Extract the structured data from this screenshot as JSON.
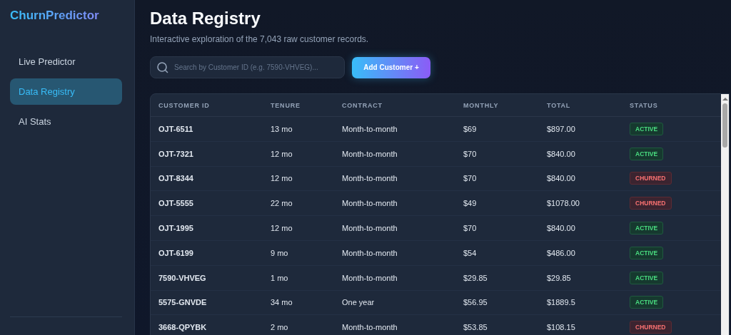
{
  "sidebar": {
    "logo": "ChurnPredictor",
    "items": [
      {
        "label": "Live Predictor",
        "selected": false
      },
      {
        "label": "Data Registry",
        "selected": true
      },
      {
        "label": "AI Stats",
        "selected": false
      }
    ]
  },
  "header": {
    "title": "Data Registry",
    "subtitle": "Interactive exploration of the 7,043 raw customer records."
  },
  "search": {
    "placeholder": "Search by Customer ID (e.g. 7590-VHVEG)..."
  },
  "add_button": "Add Customer +",
  "table": {
    "columns": [
      "CUSTOMER ID",
      "TENURE",
      "CONTRACT",
      "MONTHLY",
      "TOTAL",
      "STATUS"
    ],
    "rows": [
      {
        "id": "OJT-6511",
        "tenure": "13 mo",
        "contract": "Month-to-month",
        "monthly": "$69",
        "total": "$897.00",
        "status": "ACTIVE",
        "kind": "active"
      },
      {
        "id": "OJT-7321",
        "tenure": "12 mo",
        "contract": "Month-to-month",
        "monthly": "$70",
        "total": "$840.00",
        "status": "ACTIVE",
        "kind": "active"
      },
      {
        "id": "OJT-8344",
        "tenure": "12 mo",
        "contract": "Month-to-month",
        "monthly": "$70",
        "total": "$840.00",
        "status": "CHURNED",
        "kind": "churned"
      },
      {
        "id": "OJT-5555",
        "tenure": "22 mo",
        "contract": "Month-to-month",
        "monthly": "$49",
        "total": "$1078.00",
        "status": "CHURNED",
        "kind": "churned"
      },
      {
        "id": "OJT-1995",
        "tenure": "12 mo",
        "contract": "Month-to-month",
        "monthly": "$70",
        "total": "$840.00",
        "status": "ACTIVE",
        "kind": "active"
      },
      {
        "id": "OJT-6199",
        "tenure": "9 mo",
        "contract": "Month-to-month",
        "monthly": "$54",
        "total": "$486.00",
        "status": "ACTIVE",
        "kind": "active"
      },
      {
        "id": "7590-VHVEG",
        "tenure": "1 mo",
        "contract": "Month-to-month",
        "monthly": "$29.85",
        "total": "$29.85",
        "status": "ACTIVE",
        "kind": "active"
      },
      {
        "id": "5575-GNVDE",
        "tenure": "34 mo",
        "contract": "One year",
        "monthly": "$56.95",
        "total": "$1889.5",
        "status": "ACTIVE",
        "kind": "active"
      },
      {
        "id": "3668-QPYBK",
        "tenure": "2 mo",
        "contract": "Month-to-month",
        "monthly": "$53.85",
        "total": "$108.15",
        "status": "CHURNED",
        "kind": "churned"
      }
    ]
  }
}
